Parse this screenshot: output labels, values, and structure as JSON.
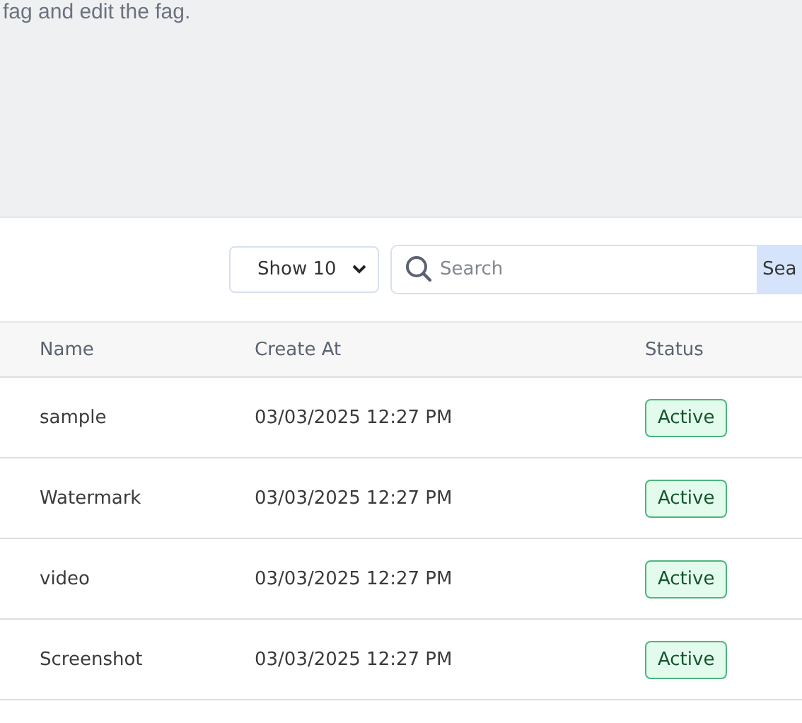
{
  "header": {
    "description": "fag and edit the fag."
  },
  "toolbar": {
    "page_size": "Show 10",
    "search": {
      "placeholder": "Search"
    },
    "search_button": "Sea"
  },
  "table": {
    "columns": [
      "Name",
      "Create At",
      "Status"
    ],
    "rows": [
      {
        "name": "sample",
        "created": "03/03/2025 12:27 PM",
        "status": {
          "label": "Active",
          "kind": "active"
        }
      },
      {
        "name": "Watermark",
        "created": "03/03/2025 12:27 PM",
        "status": {
          "label": "Active",
          "kind": "active"
        }
      },
      {
        "name": "video",
        "created": "03/03/2025 12:27 PM",
        "status": {
          "label": "Active",
          "kind": "active"
        }
      },
      {
        "name": "Screenshot",
        "created": "03/03/2025 12:27 PM",
        "status": {
          "label": "Active",
          "kind": "active"
        }
      }
    ]
  }
}
